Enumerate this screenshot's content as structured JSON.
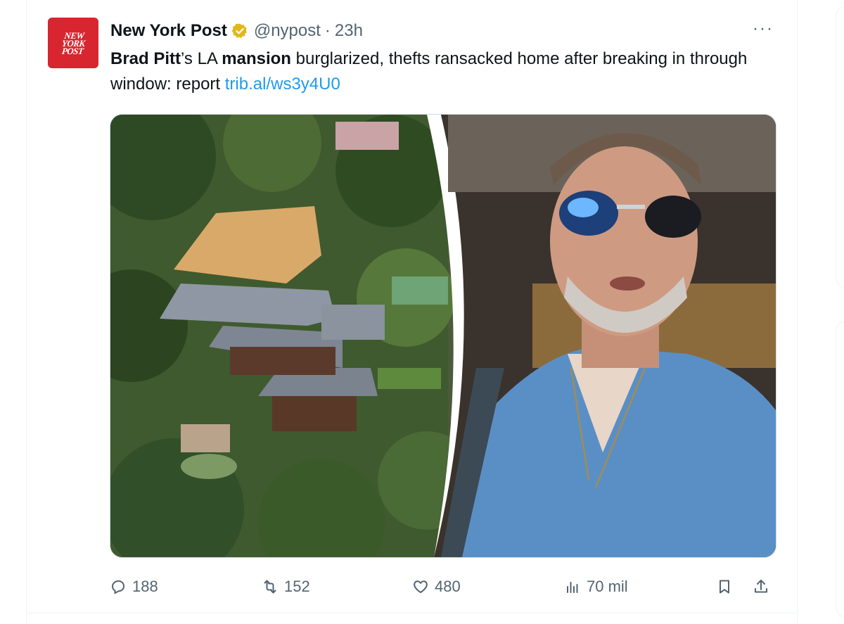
{
  "tweet": {
    "author_name": "New York Post",
    "handle": "@nypost",
    "separator": "·",
    "time": "23h",
    "avatar_text_line1": "NEW",
    "avatar_text_line2": "YORK",
    "avatar_text_line3": "POST",
    "more_label": "···",
    "text_part1": "Brad Pitt",
    "text_part2": "’s LA ",
    "text_part3": "mansion",
    "text_part4": " burglarized, thefts ransacked home after breaking in through window: report ",
    "link": "trib.al/ws3y4U0"
  },
  "actions": {
    "reply_count": "188",
    "retweet_count": "152",
    "like_count": "480",
    "views_count": "70 mil"
  },
  "icons": {
    "verified": "verified-badge-icon",
    "reply": "reply-icon",
    "retweet": "retweet-icon",
    "like": "heart-icon",
    "views": "views-chart-icon",
    "bookmark": "bookmark-icon",
    "share": "share-icon"
  },
  "colors": {
    "link": "#1d9bf0",
    "secondary_text": "#536471",
    "verified_gold": "#e2b719",
    "avatar_red": "#d7262f"
  }
}
